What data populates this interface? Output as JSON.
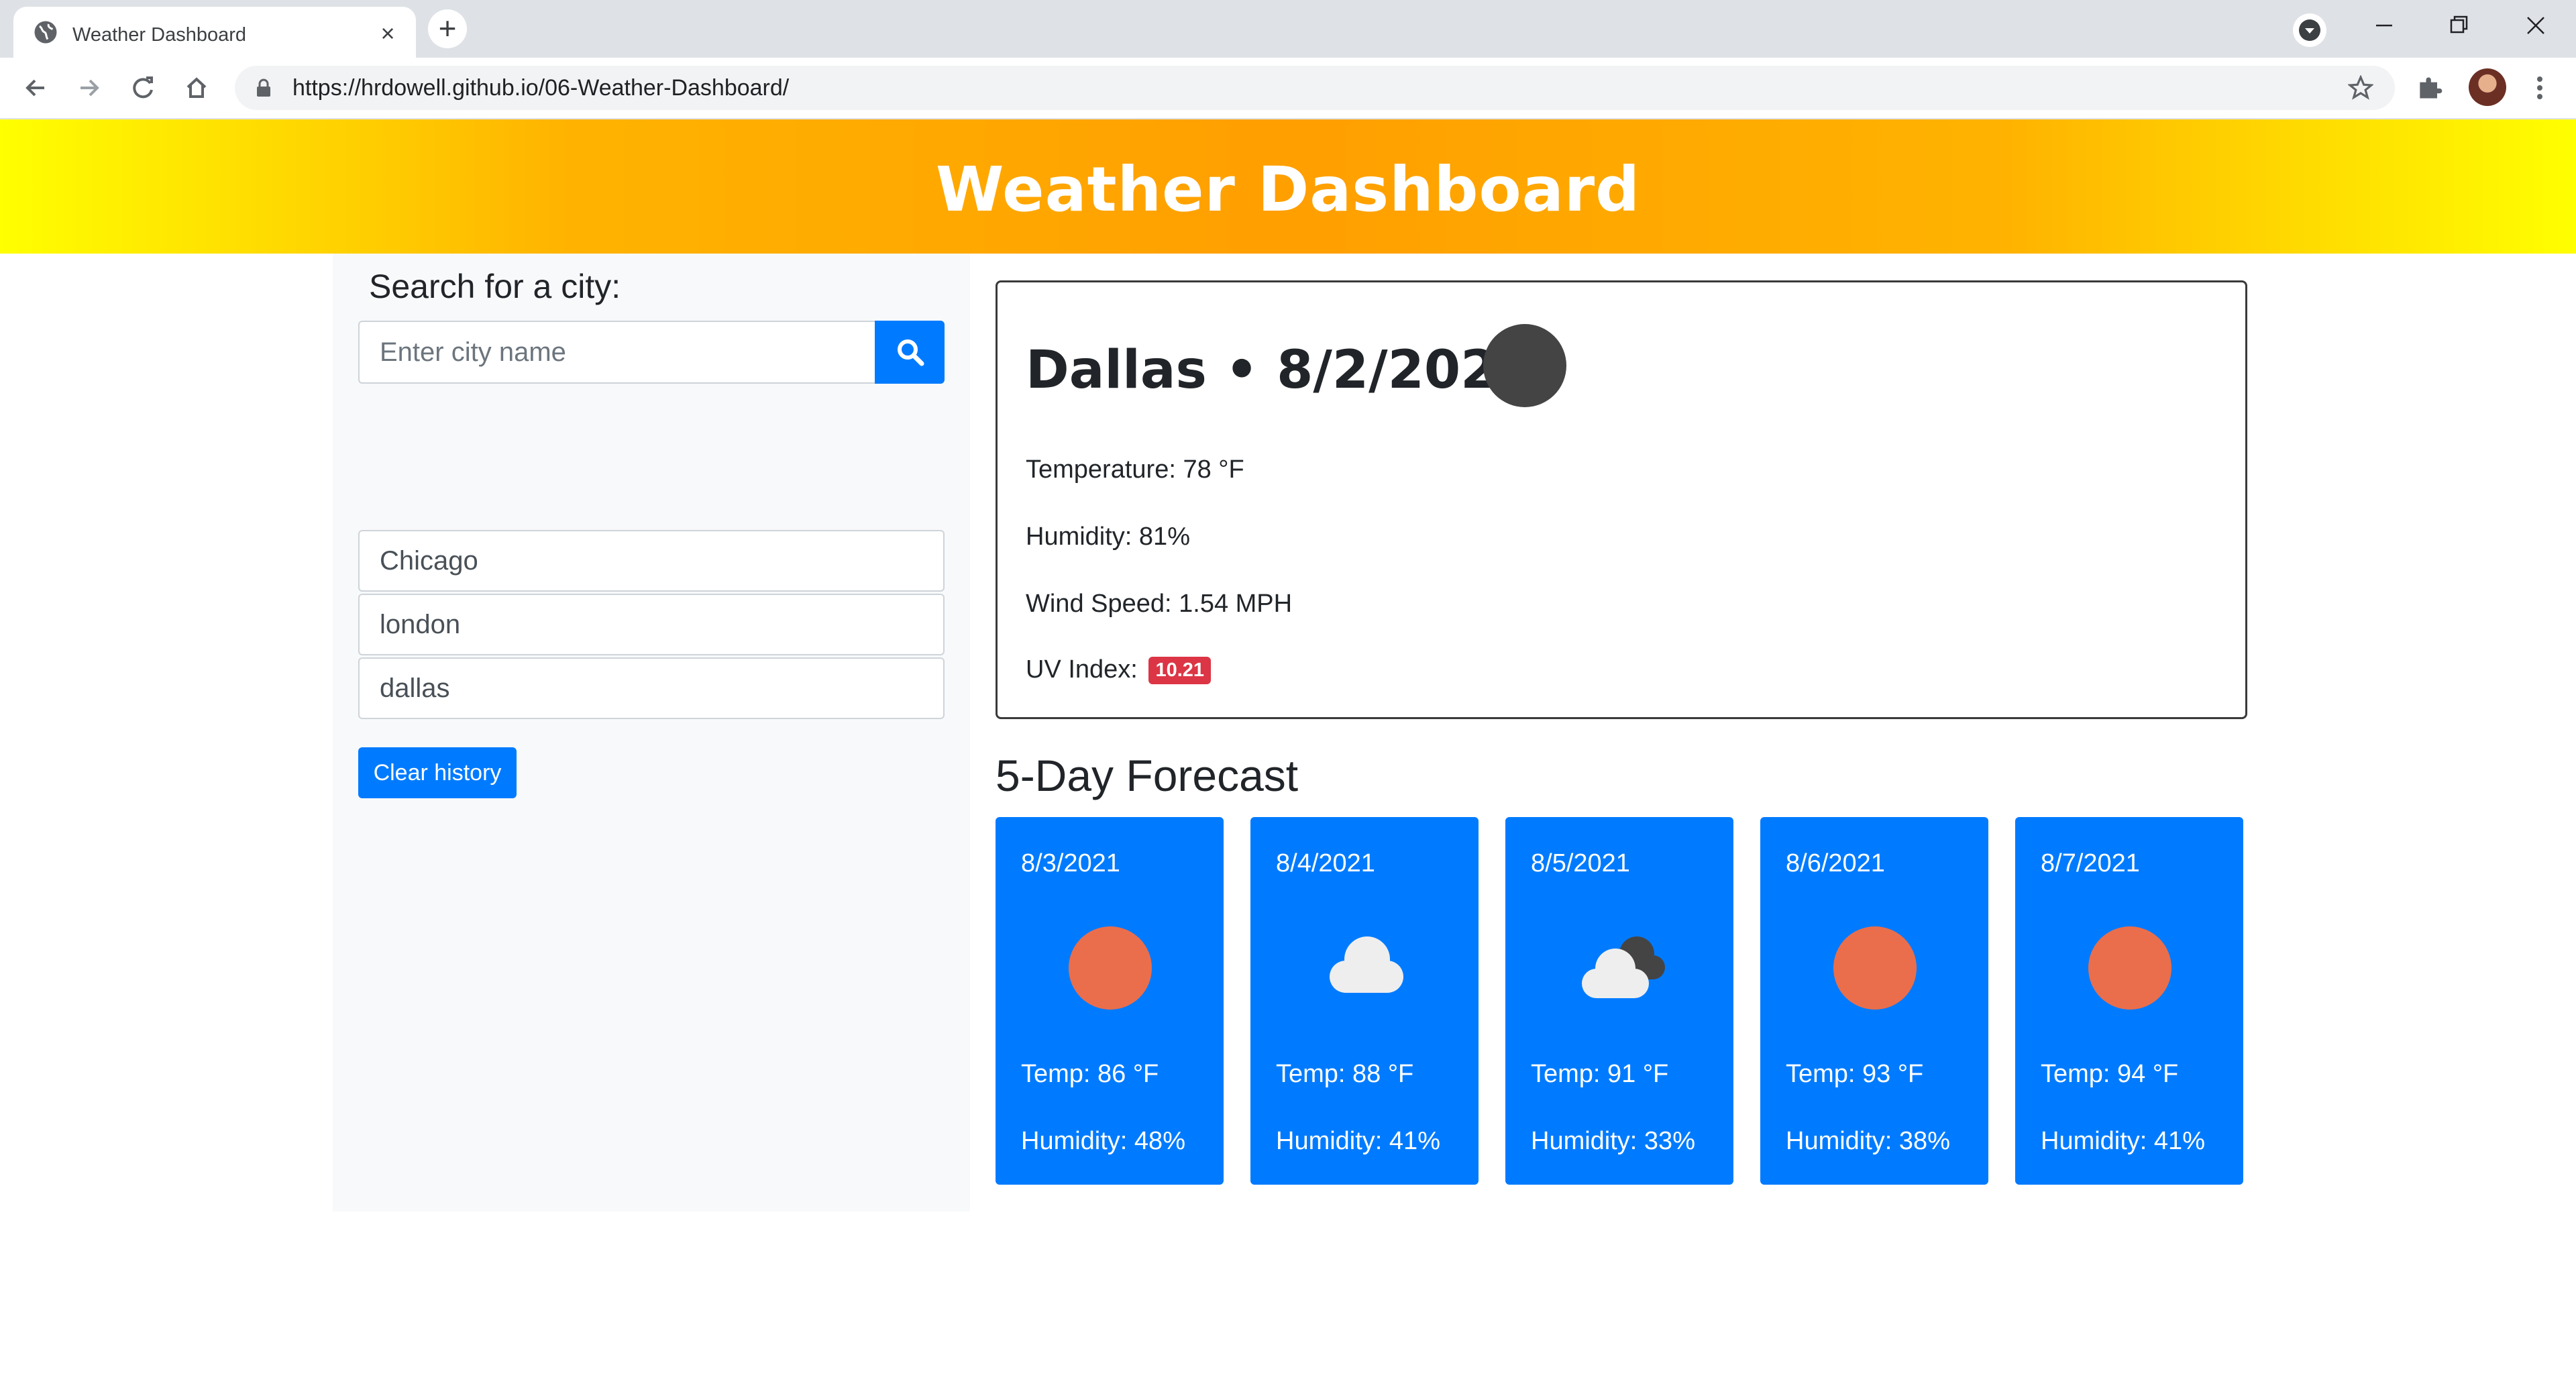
{
  "browser": {
    "tab_title": "Weather Dashboard",
    "tab_close": "×",
    "new_tab": "+",
    "url": "https://hrdowell.github.io/06-Weather-Dashboard/"
  },
  "header": {
    "title": "Weather Dashboard"
  },
  "sidebar": {
    "search_label": "Search for a city:",
    "search_placeholder": "Enter city name",
    "history": [
      "Chicago",
      "london",
      "dallas"
    ],
    "clear_label": "Clear history"
  },
  "current": {
    "city": "Dallas",
    "separator": "•",
    "date": "8/2/2021",
    "icon": "dark-moon-icon",
    "temperature": "Temperature: 78 °F",
    "humidity": "Humidity: 81%",
    "wind": "Wind Speed: 1.54 MPH",
    "uv_label": "UV Index:",
    "uv_value": "10.21",
    "uv_color": "#dc3545"
  },
  "forecast": {
    "title": "5-Day Forecast",
    "days": [
      {
        "date": "8/3/2021",
        "icon": "sun-icon",
        "temp": "Temp: 86 °F",
        "humidity": "Humidity: 48%"
      },
      {
        "date": "8/4/2021",
        "icon": "cloud-icon",
        "temp": "Temp: 88 °F",
        "humidity": "Humidity: 41%"
      },
      {
        "date": "8/5/2021",
        "icon": "clouds-icon",
        "temp": "Temp: 91 °F",
        "humidity": "Humidity: 33%"
      },
      {
        "date": "8/6/2021",
        "icon": "sun-icon",
        "temp": "Temp: 93 °F",
        "humidity": "Humidity: 38%"
      },
      {
        "date": "8/7/2021",
        "icon": "sun-icon",
        "temp": "Temp: 94 °F",
        "humidity": "Humidity: 41%"
      }
    ]
  },
  "colors": {
    "primary": "#007bff",
    "sun": "#ea6e4b",
    "banner_yellow": "#ffff00",
    "banner_orange": "#ff9f00"
  }
}
